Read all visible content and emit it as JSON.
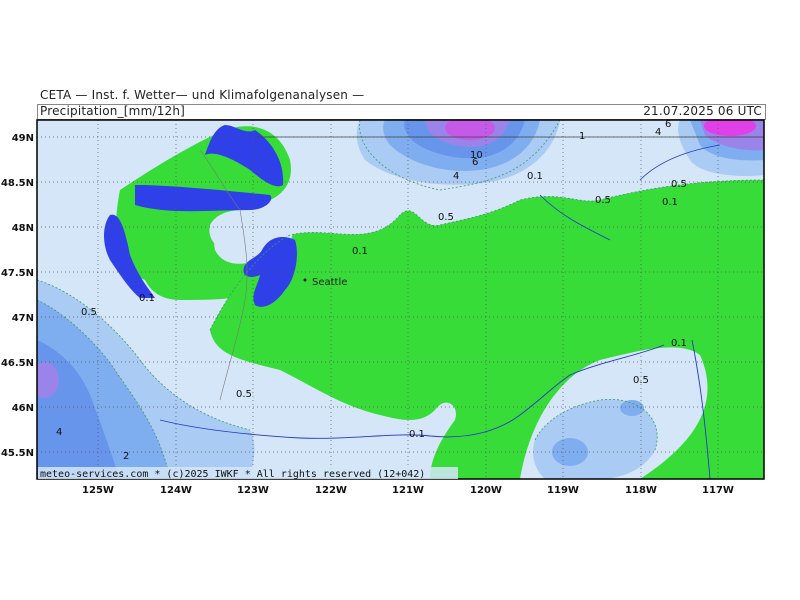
{
  "header": {
    "institute": "CETA — Inst. f. Wetter— und Klimafolgenanalysen —",
    "parameter": "Precipitation_[mm/12h]",
    "valid_time": "21.07.2025 06 UTC"
  },
  "footer": "meteo-services.com * (c)2025 IWKF * All rights reserved (12+042)",
  "axes": {
    "lat_labels": [
      "49N",
      "48.5N",
      "48N",
      "47.5N",
      "47N",
      "46.5N",
      "46N",
      "45.5N"
    ],
    "lon_labels": [
      "125W",
      "124W",
      "123W",
      "122W",
      "121W",
      "120W",
      "119W",
      "118W",
      "117W"
    ]
  },
  "cities": [
    {
      "name": "Seattle"
    }
  ],
  "contour_labels": [
    "1",
    "4",
    "6",
    "10",
    "6",
    "4",
    "0.1",
    "0.5",
    "0.5",
    "0.1",
    "0.5",
    "0.1",
    "0.1",
    "0.5",
    "0.5",
    "0.1",
    "0.5",
    "0.1",
    "4",
    "2"
  ],
  "colors": {
    "green": "#38dc38",
    "light_blue": "#d4e6f8",
    "mid_blue": "#aacbf4",
    "blue": "#7faef0",
    "deep_blue": "#6895ec",
    "lavender": "#9a84ea",
    "purple": "#c55ae8",
    "magenta": "#e040e8",
    "water": "#3040e8"
  }
}
